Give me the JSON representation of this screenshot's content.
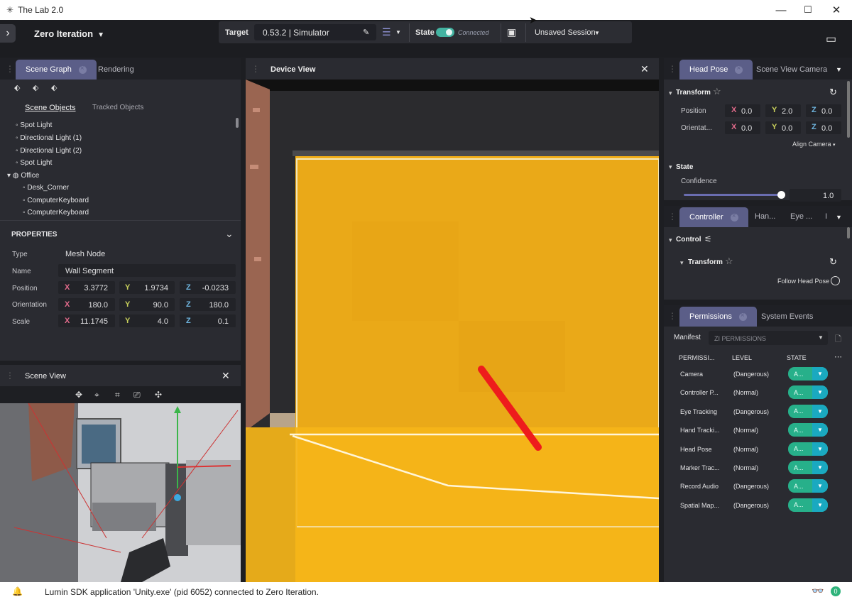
{
  "window": {
    "title": "The Lab 2.0",
    "minimize": "—",
    "maximize": "☐",
    "close": "✕"
  },
  "app": {
    "name": "Zero Iteration"
  },
  "toolbar": {
    "target_label": "Target",
    "target_value": "0.53.2 | Simulator",
    "state_label": "State",
    "state_value": "Connected",
    "session": "Unsaved Session"
  },
  "scene_graph": {
    "tabs": [
      "Scene Graph",
      "Rendering"
    ],
    "subtabs": [
      "Scene Objects",
      "Tracked Objects"
    ],
    "items": [
      "Spot Light",
      "Directional Light (1)",
      "Directional Light (2)",
      "Spot Light",
      "Office",
      "Desk_Corner",
      "ComputerKeyboard",
      "ComputerKeyboard"
    ]
  },
  "properties": {
    "title": "PROPERTIES",
    "type_label": "Type",
    "type_value": "Mesh Node",
    "name_label": "Name",
    "name_value": "Wall Segment",
    "position_label": "Position",
    "position": [
      "3.3772",
      "1.9734",
      "-0.0233"
    ],
    "orientation_label": "Orientation",
    "orientation": [
      "180.0",
      "90.0",
      "180.0"
    ],
    "scale_label": "Scale",
    "scale": [
      "11.1745",
      "4.0",
      "0.1"
    ],
    "axes": [
      "X",
      "Y",
      "Z"
    ]
  },
  "scene_view": {
    "title": "Scene View"
  },
  "device_view": {
    "title": "Device View"
  },
  "head_pose": {
    "tabs": [
      "Head Pose",
      "Scene View Camera"
    ],
    "transform_label": "Transform",
    "position_label": "Position",
    "position": [
      "0.0",
      "2.0",
      "0.0"
    ],
    "orientation_label": "Orientat...",
    "orientation": [
      "0.0",
      "0.0",
      "0.0"
    ],
    "align_camera": "Align Camera",
    "state_label": "State",
    "confidence_label": "Confidence",
    "confidence_value": "1.0",
    "confidence_fraction": 1.0
  },
  "controller": {
    "tabs": [
      "Controller",
      "Han...",
      "Eye ...",
      "I"
    ],
    "control_label": "Control",
    "transform_label": "Transform",
    "follow_head_pose": "Follow Head Pose"
  },
  "permissions": {
    "tabs": [
      "Permissions",
      "System Events"
    ],
    "manifest_label": "Manifest",
    "manifest_value": "ZI PERMISSIONS",
    "headers": [
      "PERMISSI...",
      "LEVEL",
      "STATE"
    ],
    "rows": [
      {
        "name": "Camera",
        "level": "(Dangerous)",
        "state": "A..."
      },
      {
        "name": "Controller P...",
        "level": "(Normal)",
        "state": "A..."
      },
      {
        "name": "Eye Tracking",
        "level": "(Dangerous)",
        "state": "A..."
      },
      {
        "name": "Hand Tracki...",
        "level": "(Normal)",
        "state": "A..."
      },
      {
        "name": "Head Pose",
        "level": "(Normal)",
        "state": "A..."
      },
      {
        "name": "Marker Trac...",
        "level": "(Normal)",
        "state": "A..."
      },
      {
        "name": "Record Audio",
        "level": "(Dangerous)",
        "state": "A..."
      },
      {
        "name": "Spatial Map...",
        "level": "(Dangerous)",
        "state": "A..."
      }
    ]
  },
  "status": {
    "message": "Lumin SDK application 'Unity.exe' (pid 6052) connected to Zero Iteration.",
    "badge_count": "0"
  }
}
